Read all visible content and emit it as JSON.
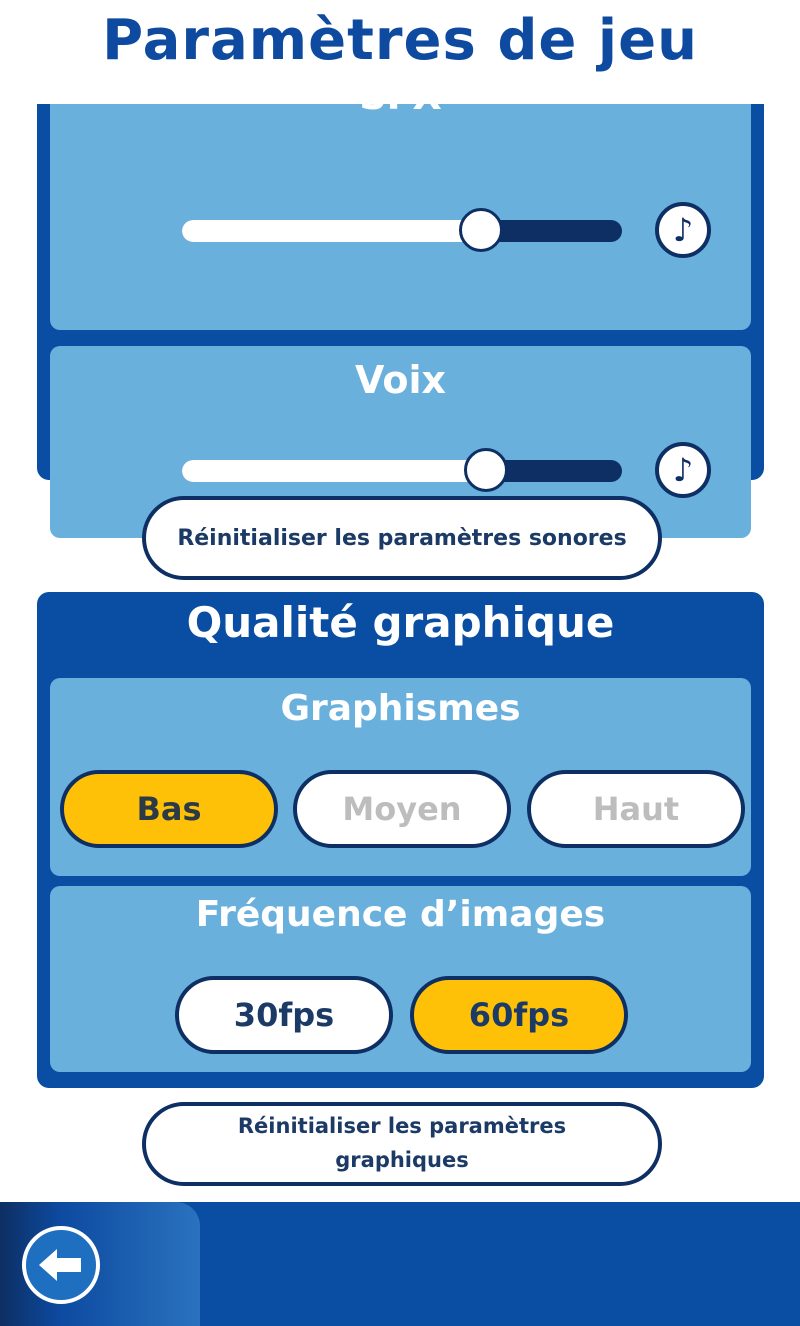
{
  "header": {
    "title": "Paramètres de jeu"
  },
  "audio": {
    "sfx": {
      "label": "SFX",
      "volume": 0.68,
      "music_icon": "music-note-icon"
    },
    "voice": {
      "label": "Voix",
      "volume": 0.69,
      "music_icon": "music-note-icon"
    },
    "reset_label": "Réinitialiser les paramètres sonores"
  },
  "graphics": {
    "title": "Qualité graphique",
    "quality": {
      "label": "Graphismes",
      "options": [
        "Bas",
        "Moyen",
        "Haut"
      ],
      "selected": "Bas"
    },
    "framerate": {
      "label": "Fréquence d’images",
      "options": [
        "30fps",
        "60fps"
      ],
      "selected": "60fps"
    },
    "reset_label": "Réinitialiser les paramètres graphiques"
  },
  "footer": {
    "back_icon": "back-arrow-icon"
  },
  "colors": {
    "primary": "#0a4ea3",
    "card": "#6ab0dc",
    "selected": "#ffc107",
    "dark": "#0d2f63"
  }
}
